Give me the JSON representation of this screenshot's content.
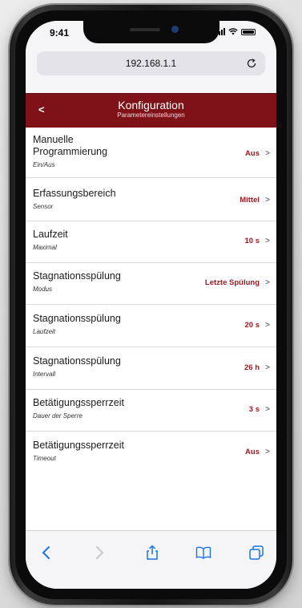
{
  "status_bar": {
    "time": "9:41"
  },
  "browser": {
    "url": "192.168.1.1"
  },
  "header": {
    "back_label": "<",
    "title": "Konfiguration",
    "subtitle": "Parametereinstellungen"
  },
  "settings": [
    {
      "title": "Manuelle\nProgrammierung",
      "subtitle": "Ein/Aus",
      "value": "Aus"
    },
    {
      "title": "Erfassungsbereich",
      "subtitle": "Sensor",
      "value": "Mittel"
    },
    {
      "title": "Laufzeit",
      "subtitle": "Maximal",
      "value": "10 s"
    },
    {
      "title": "Stagnationsspülung",
      "subtitle": "Modus",
      "value": "Letzte Spülung"
    },
    {
      "title": "Stagnationsspülung",
      "subtitle": "Laufzeit",
      "value": "20 s"
    },
    {
      "title": "Stagnationsspülung",
      "subtitle": "Intervall",
      "value": "26 h"
    },
    {
      "title": "Betätigungssperrzeit",
      "subtitle": "Dauer der Sperre",
      "value": "3 s"
    },
    {
      "title": "Betätigungssperrzeit",
      "subtitle": "Timeout",
      "value": "Aus"
    }
  ],
  "chevron": ">",
  "colors": {
    "accent": "#7f1219",
    "value_text": "#a01820",
    "safari_blue": "#1a73e8"
  },
  "toolbar": {
    "icons": [
      "back-arrow-icon",
      "forward-arrow-icon",
      "share-icon",
      "bookmarks-icon",
      "tabs-icon"
    ]
  }
}
